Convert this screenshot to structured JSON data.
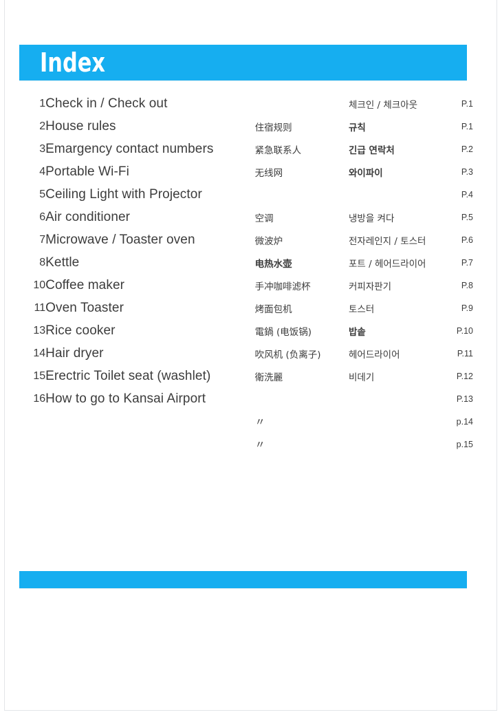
{
  "header": {
    "title": "Index",
    "bar_color": "#16aef0"
  },
  "footer": {
    "bar_color": "#16aef0"
  },
  "rows": [
    {
      "num": "1",
      "en": "Check in / Check out",
      "zh": "",
      "ko": "체크인 / 체크아웃",
      "page": "P.1"
    },
    {
      "num": "2",
      "en": "House rules",
      "zh": "住宿规则",
      "ko": "규칙",
      "page": "P.1"
    },
    {
      "num": "3",
      "en": "Emargency contact numbers",
      "zh": "紧急联系人",
      "ko": "긴급 연락처",
      "page": "P.2"
    },
    {
      "num": "4",
      "en": "Portable Wi-Fi",
      "zh": "无线网",
      "ko": "와이파이",
      "page": "P.3"
    },
    {
      "num": "5",
      "en": "Ceiling Light with Projector",
      "zh": "",
      "ko": "",
      "page": "P.4"
    },
    {
      "num": "6",
      "en": "Air conditioner",
      "zh": "空调",
      "ko": "냉방을 켜다",
      "page": "P.5"
    },
    {
      "num": "7",
      "en": "Microwave / Toaster oven",
      "zh": "微波炉",
      "ko": "전자레인지 / 토스터",
      "page": "P.6"
    },
    {
      "num": "8",
      "en": "Kettle",
      "zh": "电热水壶",
      "ko": "포트 / 헤어드라이어",
      "page": "P.7"
    },
    {
      "num": "10",
      "en": "Coffee maker",
      "zh": "手冲咖啡滤杯",
      "ko": "커피자판기",
      "page": "P.8"
    },
    {
      "num": "11",
      "en": "Oven Toaster",
      "zh": "烤面包机",
      "ko": "토스터",
      "page": "P.9"
    },
    {
      "num": "13",
      "en": "Rice cooker",
      "zh": "電鍋 (电饭锅)",
      "ko": "밥솥",
      "page": "P.10"
    },
    {
      "num": "14",
      "en": "Hair dryer",
      "zh": "吹风机 (负离子)",
      "ko": "헤어드라이어",
      "page": "P.11"
    },
    {
      "num": "15",
      "en": "Erectric Toilet seat (washlet)",
      "zh": "衛洗麗",
      "ko": "비데기",
      "page": "P.12"
    },
    {
      "num": "16",
      "en": "How to go to Kansai Airport",
      "zh": "",
      "ko": "",
      "page": "P.13"
    },
    {
      "num": "",
      "en": "",
      "zh": "〃",
      "ko": "",
      "page": "p.14"
    },
    {
      "num": "",
      "en": "",
      "zh": "〃",
      "ko": "",
      "page": "p.15"
    }
  ]
}
